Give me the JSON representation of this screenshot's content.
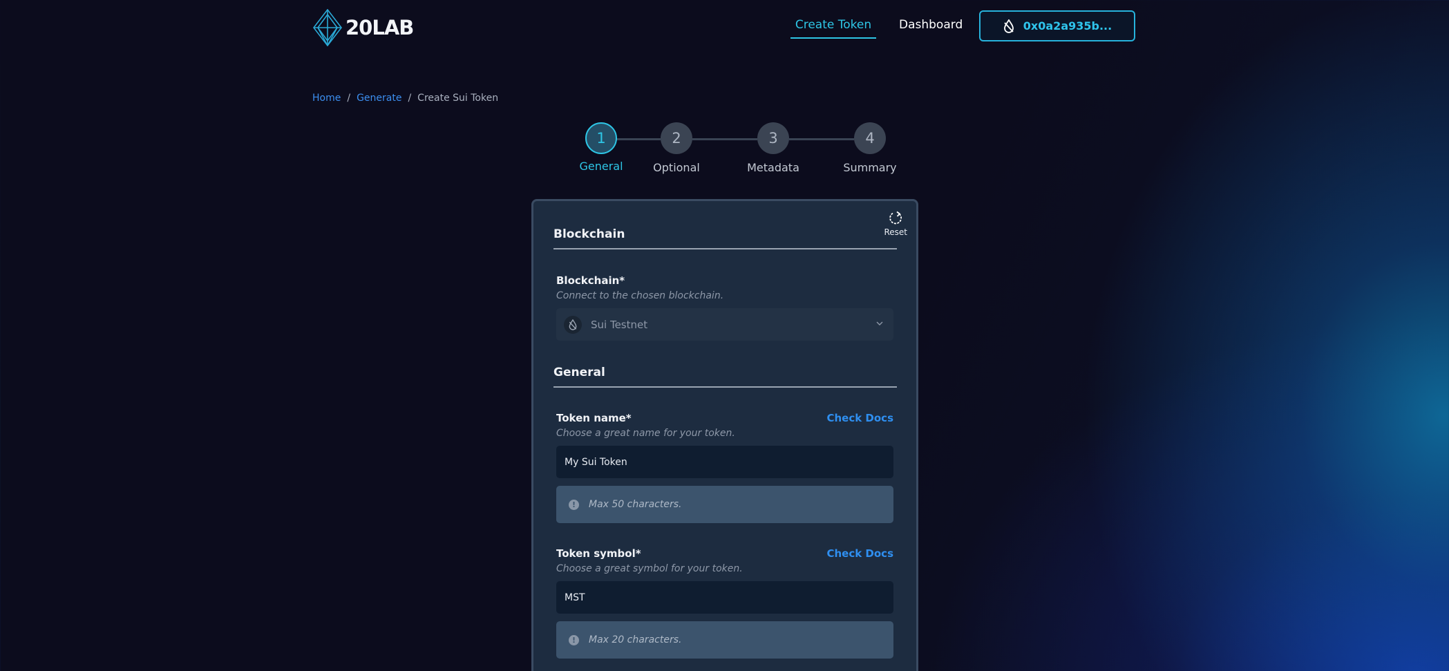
{
  "header": {
    "logo_text": "20LAB",
    "nav": {
      "create_token": "Create Token",
      "dashboard": "Dashboard"
    },
    "wallet_address": "0x0a2a935b..."
  },
  "breadcrumb": {
    "home": "Home",
    "separator": "/",
    "generate": "Generate",
    "current": "Create Sui Token"
  },
  "stepper": {
    "steps": [
      {
        "number": "1",
        "label": "General",
        "active": true
      },
      {
        "number": "2",
        "label": "Optional",
        "active": false
      },
      {
        "number": "3",
        "label": "Metadata",
        "active": false
      },
      {
        "number": "4",
        "label": "Summary",
        "active": false
      }
    ]
  },
  "form": {
    "reset_label": "Reset",
    "blockchain_section": "Blockchain",
    "blockchain_field": {
      "label": "Blockchain*",
      "help": "Connect to the chosen blockchain.",
      "selected": "Sui Testnet"
    },
    "general_section": "General",
    "token_name": {
      "label": "Token name*",
      "docs": "Check Docs",
      "help": "Choose a great name for your token.",
      "value": "My Sui Token",
      "hint": "Max 50 characters."
    },
    "token_symbol": {
      "label": "Token symbol*",
      "docs": "Check Docs",
      "help": "Choose a great symbol for your token.",
      "value": "MST",
      "hint": "Max 20 characters."
    }
  },
  "colors": {
    "accent": "#2ec6e6",
    "link": "#2f8ff0",
    "background": "#0c0c1d",
    "card": "#1d2c40"
  }
}
